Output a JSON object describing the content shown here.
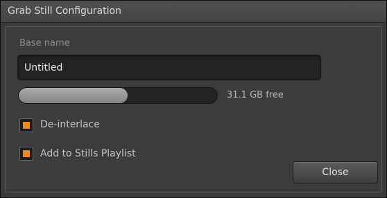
{
  "window": {
    "title": "Grab Still Configuration"
  },
  "base_name": {
    "label": "Base name",
    "value": "Untitled"
  },
  "storage": {
    "used_fraction": 0.55,
    "free_label": "31.1 GB free"
  },
  "options": {
    "deinterlace": {
      "label": "De-interlace",
      "checked": true
    },
    "add_to_playlist": {
      "label": "Add to Stills Playlist",
      "checked": true
    }
  },
  "buttons": {
    "close_label": "Close"
  },
  "colors": {
    "accent": "#f28a1e",
    "background": "#3b3b3b",
    "titlebar": "#4a4a4a"
  }
}
